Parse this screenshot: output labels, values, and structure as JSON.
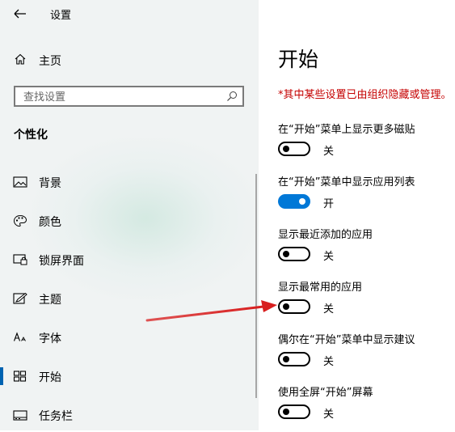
{
  "header": {
    "title": "设置"
  },
  "home": {
    "label": "主页"
  },
  "search": {
    "placeholder": "查找设置"
  },
  "sidebar": {
    "section_title": "个性化",
    "items": [
      {
        "label": "背景",
        "icon": "picture-icon"
      },
      {
        "label": "颜色",
        "icon": "palette-icon"
      },
      {
        "label": "锁屏界面",
        "icon": "lock-screen-icon"
      },
      {
        "label": "主题",
        "icon": "theme-brush-icon"
      },
      {
        "label": "字体",
        "icon": "font-icon"
      },
      {
        "label": "开始",
        "icon": "start-grid-icon",
        "selected": true
      },
      {
        "label": "任务栏",
        "icon": "taskbar-icon"
      }
    ]
  },
  "main": {
    "title": "开始",
    "policy_note": "*其中某些设置已由组织隐藏或管理。",
    "settings": [
      {
        "label": "在“开始”菜单上显示更多磁贴",
        "on": false,
        "state": "关"
      },
      {
        "label": "在“开始”菜单中显示应用列表",
        "on": true,
        "state": "开"
      },
      {
        "label": "显示最近添加的应用",
        "on": false,
        "state": "关"
      },
      {
        "label": "显示最常用的应用",
        "on": false,
        "state": "关"
      },
      {
        "label": "偶尔在“开始”菜单中显示建议",
        "on": false,
        "state": "关"
      },
      {
        "label": "使用全屏“开始”屏幕",
        "on": false,
        "state": "关"
      }
    ]
  },
  "colors": {
    "accent": "#0078d7",
    "policy_note": "#c50000",
    "annotation_arrow": "#d81e1e",
    "sidebar_bg": "#f0f3f3"
  }
}
